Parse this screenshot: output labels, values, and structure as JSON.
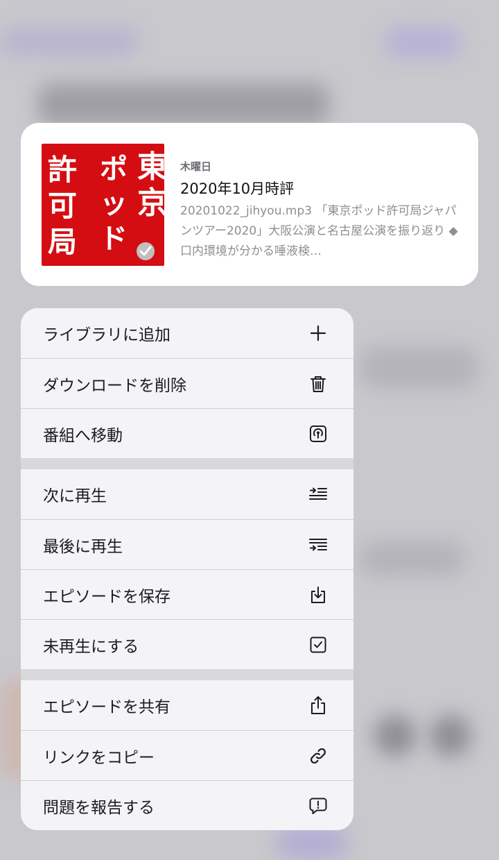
{
  "episode": {
    "day": "木曜日",
    "title": "2020年10月時評",
    "description": "20201022_jihyou.mp3 「東京ポッド許可局ジャパンツアー2020」大阪公演と名古屋公演を振り返り ◆口内環境が分かる唾液検…",
    "artwork": {
      "chars": [
        "東",
        "京",
        "ポ",
        "ッ",
        "ド",
        "許",
        "可",
        "局"
      ],
      "bg_color": "#d40d12",
      "badge_icon": "checkmark-icon"
    }
  },
  "menu": {
    "groups": [
      [
        {
          "label": "ライブラリに追加",
          "icon": "plus-icon"
        },
        {
          "label": "ダウンロードを削除",
          "icon": "trash-icon"
        },
        {
          "label": "番組へ移動",
          "icon": "podcast-icon"
        }
      ],
      [
        {
          "label": "次に再生",
          "icon": "play-next-icon"
        },
        {
          "label": "最後に再生",
          "icon": "play-last-icon"
        },
        {
          "label": "エピソードを保存",
          "icon": "save-download-icon"
        },
        {
          "label": "未再生にする",
          "icon": "checkbox-icon"
        }
      ],
      [
        {
          "label": "エピソードを共有",
          "icon": "share-icon"
        },
        {
          "label": "リンクをコピー",
          "icon": "link-icon"
        },
        {
          "label": "問題を報告する",
          "icon": "report-icon"
        }
      ]
    ]
  }
}
